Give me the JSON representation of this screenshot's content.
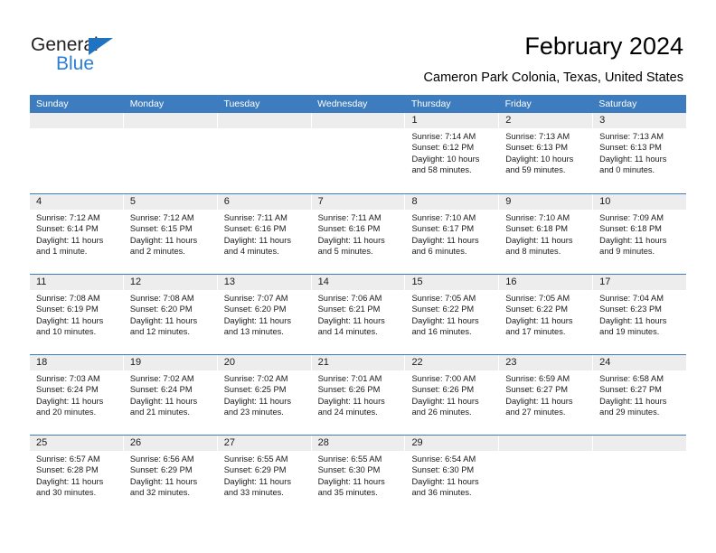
{
  "logo": {
    "word1": "General",
    "word2": "Blue",
    "triangle_color": "#1f73c0",
    "blue_color": "#2a7fd4"
  },
  "header": {
    "title": "February 2024",
    "subtitle": "Cameron Park Colonia, Texas, United States"
  },
  "theme": {
    "header_blue": "#3d7dbf",
    "daynum_gray": "#ededed",
    "text": "#1a1a1a"
  },
  "calendar": {
    "weekdays": [
      "Sunday",
      "Monday",
      "Tuesday",
      "Wednesday",
      "Thursday",
      "Friday",
      "Saturday"
    ],
    "weeks": [
      [
        {
          "day": ""
        },
        {
          "day": ""
        },
        {
          "day": ""
        },
        {
          "day": ""
        },
        {
          "day": "1",
          "sunrise": "Sunrise: 7:14 AM",
          "sunset": "Sunset: 6:12 PM",
          "daylight1": "Daylight: 10 hours",
          "daylight2": "and 58 minutes."
        },
        {
          "day": "2",
          "sunrise": "Sunrise: 7:13 AM",
          "sunset": "Sunset: 6:13 PM",
          "daylight1": "Daylight: 10 hours",
          "daylight2": "and 59 minutes."
        },
        {
          "day": "3",
          "sunrise": "Sunrise: 7:13 AM",
          "sunset": "Sunset: 6:13 PM",
          "daylight1": "Daylight: 11 hours",
          "daylight2": "and 0 minutes."
        }
      ],
      [
        {
          "day": "4",
          "sunrise": "Sunrise: 7:12 AM",
          "sunset": "Sunset: 6:14 PM",
          "daylight1": "Daylight: 11 hours",
          "daylight2": "and 1 minute."
        },
        {
          "day": "5",
          "sunrise": "Sunrise: 7:12 AM",
          "sunset": "Sunset: 6:15 PM",
          "daylight1": "Daylight: 11 hours",
          "daylight2": "and 2 minutes."
        },
        {
          "day": "6",
          "sunrise": "Sunrise: 7:11 AM",
          "sunset": "Sunset: 6:16 PM",
          "daylight1": "Daylight: 11 hours",
          "daylight2": "and 4 minutes."
        },
        {
          "day": "7",
          "sunrise": "Sunrise: 7:11 AM",
          "sunset": "Sunset: 6:16 PM",
          "daylight1": "Daylight: 11 hours",
          "daylight2": "and 5 minutes."
        },
        {
          "day": "8",
          "sunrise": "Sunrise: 7:10 AM",
          "sunset": "Sunset: 6:17 PM",
          "daylight1": "Daylight: 11 hours",
          "daylight2": "and 6 minutes."
        },
        {
          "day": "9",
          "sunrise": "Sunrise: 7:10 AM",
          "sunset": "Sunset: 6:18 PM",
          "daylight1": "Daylight: 11 hours",
          "daylight2": "and 8 minutes."
        },
        {
          "day": "10",
          "sunrise": "Sunrise: 7:09 AM",
          "sunset": "Sunset: 6:18 PM",
          "daylight1": "Daylight: 11 hours",
          "daylight2": "and 9 minutes."
        }
      ],
      [
        {
          "day": "11",
          "sunrise": "Sunrise: 7:08 AM",
          "sunset": "Sunset: 6:19 PM",
          "daylight1": "Daylight: 11 hours",
          "daylight2": "and 10 minutes."
        },
        {
          "day": "12",
          "sunrise": "Sunrise: 7:08 AM",
          "sunset": "Sunset: 6:20 PM",
          "daylight1": "Daylight: 11 hours",
          "daylight2": "and 12 minutes."
        },
        {
          "day": "13",
          "sunrise": "Sunrise: 7:07 AM",
          "sunset": "Sunset: 6:20 PM",
          "daylight1": "Daylight: 11 hours",
          "daylight2": "and 13 minutes."
        },
        {
          "day": "14",
          "sunrise": "Sunrise: 7:06 AM",
          "sunset": "Sunset: 6:21 PM",
          "daylight1": "Daylight: 11 hours",
          "daylight2": "and 14 minutes."
        },
        {
          "day": "15",
          "sunrise": "Sunrise: 7:05 AM",
          "sunset": "Sunset: 6:22 PM",
          "daylight1": "Daylight: 11 hours",
          "daylight2": "and 16 minutes."
        },
        {
          "day": "16",
          "sunrise": "Sunrise: 7:05 AM",
          "sunset": "Sunset: 6:22 PM",
          "daylight1": "Daylight: 11 hours",
          "daylight2": "and 17 minutes."
        },
        {
          "day": "17",
          "sunrise": "Sunrise: 7:04 AM",
          "sunset": "Sunset: 6:23 PM",
          "daylight1": "Daylight: 11 hours",
          "daylight2": "and 19 minutes."
        }
      ],
      [
        {
          "day": "18",
          "sunrise": "Sunrise: 7:03 AM",
          "sunset": "Sunset: 6:24 PM",
          "daylight1": "Daylight: 11 hours",
          "daylight2": "and 20 minutes."
        },
        {
          "day": "19",
          "sunrise": "Sunrise: 7:02 AM",
          "sunset": "Sunset: 6:24 PM",
          "daylight1": "Daylight: 11 hours",
          "daylight2": "and 21 minutes."
        },
        {
          "day": "20",
          "sunrise": "Sunrise: 7:02 AM",
          "sunset": "Sunset: 6:25 PM",
          "daylight1": "Daylight: 11 hours",
          "daylight2": "and 23 minutes."
        },
        {
          "day": "21",
          "sunrise": "Sunrise: 7:01 AM",
          "sunset": "Sunset: 6:26 PM",
          "daylight1": "Daylight: 11 hours",
          "daylight2": "and 24 minutes."
        },
        {
          "day": "22",
          "sunrise": "Sunrise: 7:00 AM",
          "sunset": "Sunset: 6:26 PM",
          "daylight1": "Daylight: 11 hours",
          "daylight2": "and 26 minutes."
        },
        {
          "day": "23",
          "sunrise": "Sunrise: 6:59 AM",
          "sunset": "Sunset: 6:27 PM",
          "daylight1": "Daylight: 11 hours",
          "daylight2": "and 27 minutes."
        },
        {
          "day": "24",
          "sunrise": "Sunrise: 6:58 AM",
          "sunset": "Sunset: 6:27 PM",
          "daylight1": "Daylight: 11 hours",
          "daylight2": "and 29 minutes."
        }
      ],
      [
        {
          "day": "25",
          "sunrise": "Sunrise: 6:57 AM",
          "sunset": "Sunset: 6:28 PM",
          "daylight1": "Daylight: 11 hours",
          "daylight2": "and 30 minutes."
        },
        {
          "day": "26",
          "sunrise": "Sunrise: 6:56 AM",
          "sunset": "Sunset: 6:29 PM",
          "daylight1": "Daylight: 11 hours",
          "daylight2": "and 32 minutes."
        },
        {
          "day": "27",
          "sunrise": "Sunrise: 6:55 AM",
          "sunset": "Sunset: 6:29 PM",
          "daylight1": "Daylight: 11 hours",
          "daylight2": "and 33 minutes."
        },
        {
          "day": "28",
          "sunrise": "Sunrise: 6:55 AM",
          "sunset": "Sunset: 6:30 PM",
          "daylight1": "Daylight: 11 hours",
          "daylight2": "and 35 minutes."
        },
        {
          "day": "29",
          "sunrise": "Sunrise: 6:54 AM",
          "sunset": "Sunset: 6:30 PM",
          "daylight1": "Daylight: 11 hours",
          "daylight2": "and 36 minutes."
        },
        {
          "day": ""
        },
        {
          "day": ""
        }
      ]
    ]
  }
}
